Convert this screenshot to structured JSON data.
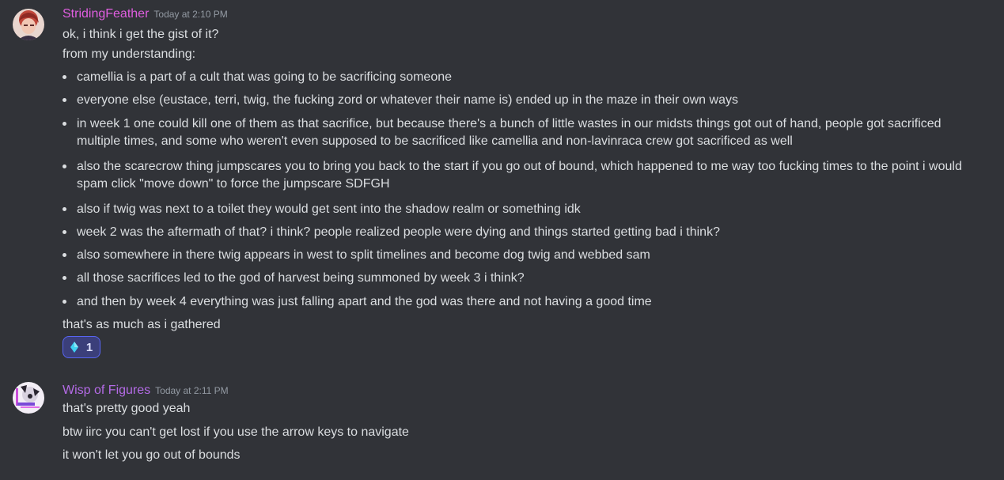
{
  "messages": [
    {
      "username": "StridingFeather",
      "username_color": "#e05ee0",
      "timestamp": "Today at 2:10 PM",
      "lines_before": [
        "ok, i think i get the gist of it?",
        "from my understanding:"
      ],
      "bullets": [
        "camellia is a part of a cult that was going to be sacrificing someone",
        "everyone else (eustace, terri, twig, the fucking zord or whatever their name is) ended up in the maze in their own ways",
        "in week 1 one could kill one of them as that sacrifice, but because there's a bunch of little wastes in our midsts things got out of hand, people got sacrificed multiple times, and some who weren't even supposed to be sacrificed like camellia and non-lavinraca crew got sacrificed as well",
        "also the scarecrow thing jumpscares you to bring you back to the start if you go out of bound, which happened to me way too fucking times to the point i would spam click \"move down\" to force the jumpscare SDFGH",
        "also if twig was next to a toilet they would get sent into the shadow realm or something idk",
        "week 2 was the aftermath of that? i think? people realized people were dying and things started getting bad i think?",
        "also somewhere in there twig appears in west to split timelines and become dog twig and webbed sam",
        "all those sacrifices led to the god of harvest being summoned by week 3 i think?",
        "and then by week 4 everything was just falling apart and the god was there and not having a good time"
      ],
      "lines_after": [
        "that's as much as i gathered"
      ],
      "reaction": {
        "emoji": "gem-icon",
        "count": "1",
        "accent": "#5865f2"
      }
    },
    {
      "username": "Wisp of Figures",
      "username_color": "#b46be6",
      "timestamp": "Today at 2:11 PM",
      "lines": [
        "that's pretty good yeah",
        "btw iirc you can't get lost if you use the arrow keys to navigate",
        "it won't let you go out of bounds"
      ]
    }
  ]
}
